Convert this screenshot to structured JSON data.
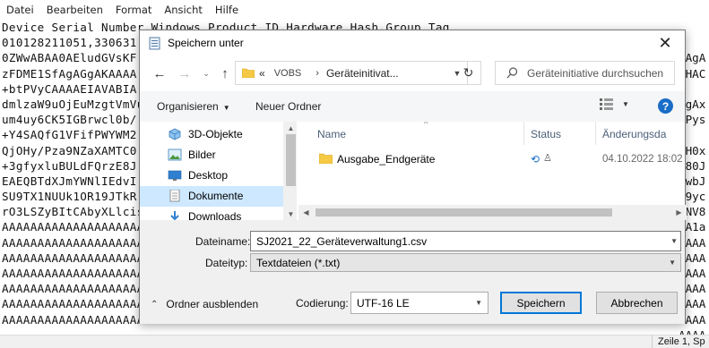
{
  "notepad": {
    "menu": [
      "Datei",
      "Bearbeiten",
      "Format",
      "Ansicht",
      "Hilfe"
    ],
    "lines": [
      "Device Serial Number,Windows Product ID,Hardware Hash,Group Tag",
      "010128211051,330631",
      "0ZWwABAA0AEludGVsKF",
      "zFDME1SfAgAGgAKAAAA",
      "+btPVyCAAAAEIAVABIA",
      "dmlzaW9uOjEuMzgtVmVu",
      "um4uy6CK5IGBrwcl0b/",
      "+Y4SAQfG1VFifPWYWM2",
      "QjOHy/Pza9NZaXAMTC0",
      "+3gfyxluBULdFQrzE8J",
      "EAEQBTdXJmYWNlIEdvI",
      "SU9TX1NUUk1OR19JTkR",
      "rO3LSZyBItCAbyXLlcis",
      "AAAAAAAAAAAAAAAAAAAAAAAAAAAAAAAAAAAAAAAAAAAAAAAAAAAAAAAAAAAAAAAAAAA",
      "AAAAAAAAAAAAAAAAAAAAAAAAAAAAAAAAAAAAAAAAAAAAAAAAAAAAAAAAAAAAAAAAAAA",
      "AAAAAAAAAAAAAAAAAAAAAAAAAAAAAAAAAAAAAAAAAAAAAAAAAAAAAAAAAAAAAAAAAAA",
      "AAAAAAAAAAAAAAAAAAAAAAAAAAAAAAAAAAAAAAAAAAAAAAAAAAAAAAAAAAAAAAAAAAA",
      "AAAAAAAAAAAAAAAAAAAAAAAAAAAAAAAAAAAAAAAAAAAAAAAAAAAAAAAAAAAAAAAAAAA",
      "AAAAAAAAAAAAAAAAAAAAAAAAAAAAAAAAAAAAAAAAAAAAAAAAAAAAAAAAAAAAAAAAAAA",
      "AAAAAAAAAAAAAAAAAAAAAAAAAAAAAAAAAAAAAAAAAAAAAAAAAAAAAAAAAAAAAAAAAAA"
    ],
    "right_lines": [
      "",
      "",
      "AAgA",
      "EHAC",
      "",
      "QgAx",
      "TPys",
      "",
      "0H0x",
      "180J",
      "9wbJ",
      "29yc",
      "DNV8",
      "ZA1a",
      "AAAA",
      "AAAA",
      "AAAA",
      "AAAA",
      "AAAA",
      "AAAA",
      "AAAA"
    ],
    "status_position": "Zeile 1, Sp"
  },
  "dialog": {
    "title": "Speichern unter",
    "address": {
      "prefix": "«",
      "segments": [
        "VOBS",
        "Geräteinitivat..."
      ]
    },
    "search_placeholder": "Geräteinitiative durchsuchen",
    "toolbar": {
      "organize": "Organisieren",
      "new_folder": "Neuer Ordner"
    },
    "nav_items": [
      {
        "label": "3D-Objekte",
        "icon": "3d-objects-icon"
      },
      {
        "label": "Bilder",
        "icon": "pictures-icon"
      },
      {
        "label": "Desktop",
        "icon": "desktop-icon"
      },
      {
        "label": "Dokumente",
        "icon": "documents-icon",
        "selected": true
      },
      {
        "label": "Downloads",
        "icon": "downloads-icon"
      }
    ],
    "columns": {
      "name": "Name",
      "status": "Status",
      "date": "Änderungsda"
    },
    "files": [
      {
        "name": "Ausgabe_Endgeräte",
        "date": "04.10.2022 18:02"
      }
    ],
    "form": {
      "filename_label": "Dateiname:",
      "filename_value": "SJ2021_22_Geräteverwaltung1.csv",
      "filetype_label": "Dateityp:",
      "filetype_value": "Textdateien (*.txt)",
      "hide_folders": "Ordner ausblenden",
      "encoding_label": "Codierung:",
      "encoding_value": "UTF-16 LE",
      "save": "Speichern",
      "cancel": "Abbrechen"
    }
  },
  "colors": {
    "accent": "#0078d7",
    "selected_bg": "#cde8ff",
    "folder": "#f5c944",
    "help": "#1a6dc7"
  }
}
